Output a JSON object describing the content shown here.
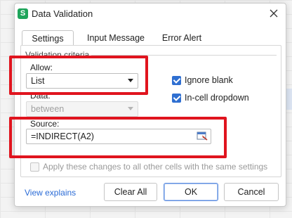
{
  "dialog": {
    "app_icon_letter": "S",
    "title": "Data Validation"
  },
  "tabs": [
    {
      "label": "Settings",
      "active": true
    },
    {
      "label": "Input Message",
      "active": false
    },
    {
      "label": "Error Alert",
      "active": false
    }
  ],
  "criteria": {
    "group_label": "Validation criteria",
    "allow_label": "Allow:",
    "allow_value": "List",
    "data_label": "Data:",
    "data_value": "between",
    "ignore_blank_label": "Ignore blank",
    "ignore_blank_checked": true,
    "in_cell_dropdown_label": "In-cell dropdown",
    "in_cell_dropdown_checked": true,
    "source_label": "Source:",
    "source_value": "=INDIRECT(A2)",
    "apply_all_label": "Apply these changes to all other cells with the same settings",
    "apply_all_checked": false
  },
  "footer": {
    "view_explains": "View explains",
    "clear_all": "Clear All",
    "ok": "OK",
    "cancel": "Cancel"
  },
  "colors": {
    "highlight": "#e0141e",
    "accent": "#2f6fd1",
    "app_icon": "#1fa55b"
  }
}
